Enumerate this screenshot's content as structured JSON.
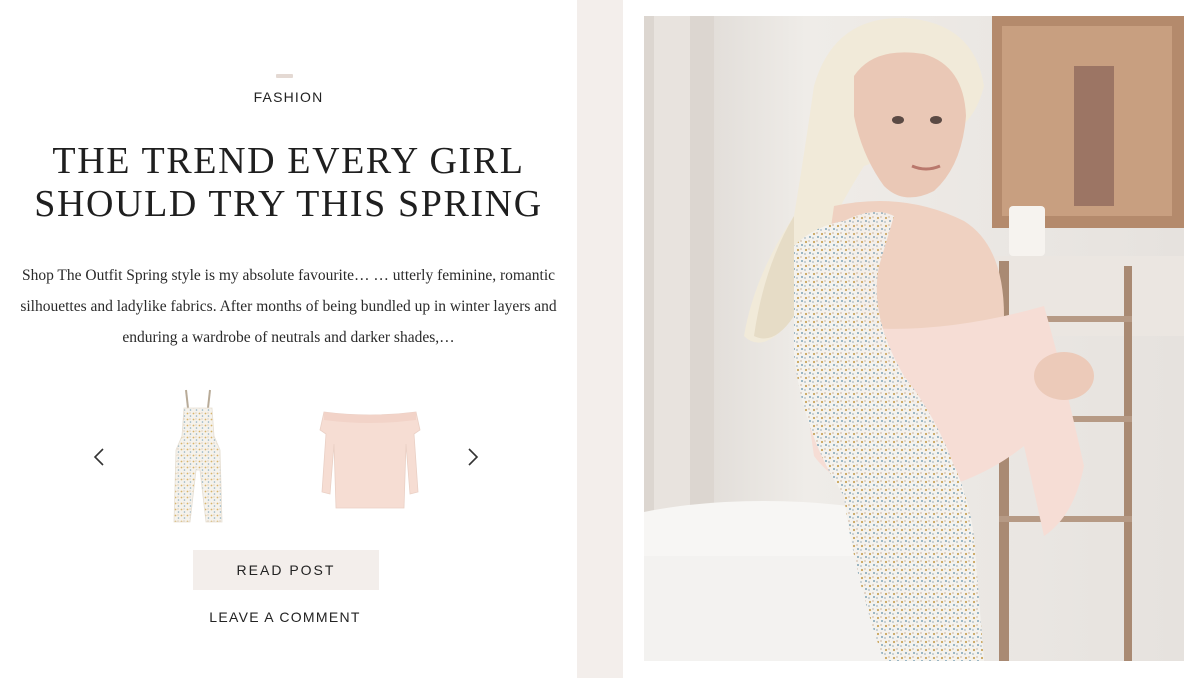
{
  "post": {
    "category": "FASHION",
    "title_line_1": "THE TREND EVERY GIRL",
    "title_line_2": "SHOULD TRY THIS SPRING",
    "excerpt": "Shop The Outfit Spring style is my absolute favourite… … utterly feminine, romantic silhouettes and ladylike fabrics. After months of being bundled up in winter layers and enduring a wardrobe of neutrals and darker shades,…",
    "read_post_label": "READ POST",
    "leave_comment_label": "LEAVE A COMMENT"
  },
  "carousel": {
    "prev_icon": "chevron-left-icon",
    "next_icon": "chevron-right-icon",
    "products": [
      {
        "name": "floral-jumpsuit",
        "description": "floral print dungaree jumpsuit"
      },
      {
        "name": "blush-off-shoulder-top",
        "description": "blush off-shoulder top"
      }
    ]
  },
  "colors": {
    "accent_band": "#f3eeeb",
    "dash": "#e4d9d3",
    "text": "#1f1f1f"
  }
}
